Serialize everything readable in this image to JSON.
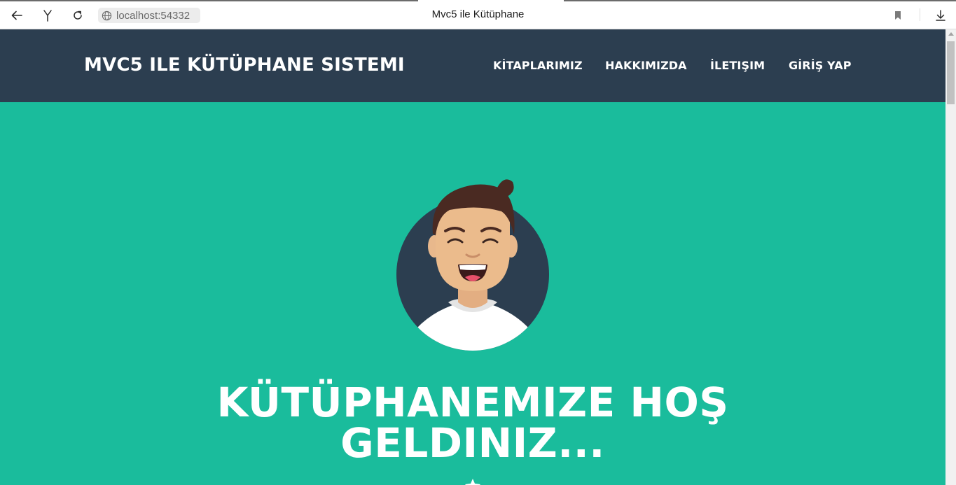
{
  "browser": {
    "url": "localhost:54332",
    "tab_title": "Mvc5 ile Kütüphane",
    "icons": [
      "back-arrow-icon",
      "yandex-y-icon",
      "reload-icon",
      "globe-icon",
      "bookmark-icon",
      "download-icon"
    ]
  },
  "navbar": {
    "brand": "MVC5 ILE KÜTÜPHANE SISTEMI",
    "links": [
      {
        "label": "KİTAPLARIMIZ"
      },
      {
        "label": "HAKKIMIZDA"
      },
      {
        "label": "İLETIŞIM"
      },
      {
        "label": "GİRİŞ YAP"
      }
    ],
    "background": "#2c3e50"
  },
  "masthead": {
    "title_line1": "KÜTÜPHANEMIZE HOŞ",
    "title_line2": "GELDINIZ...",
    "avatar_icon": "smiling-man-avatar-icon",
    "background": "#1abc9c"
  }
}
